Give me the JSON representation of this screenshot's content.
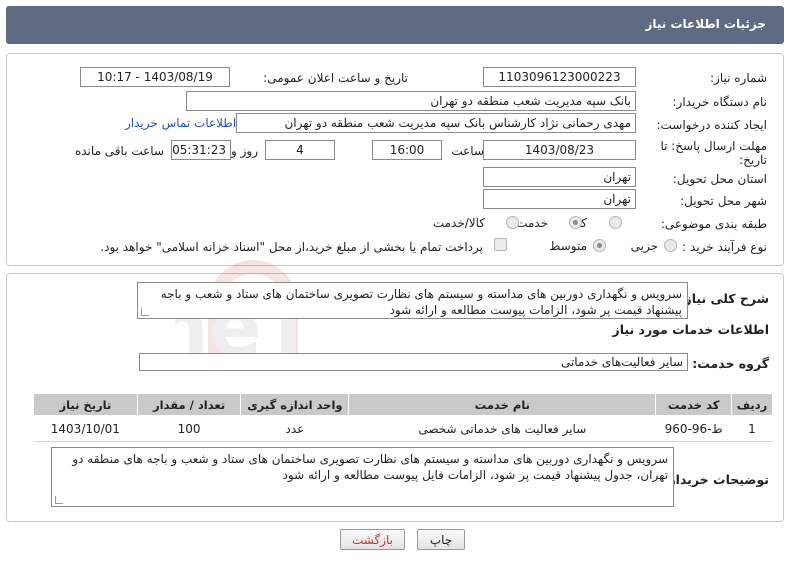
{
  "header": {
    "title": "جزئیات اطلاعات نیاز"
  },
  "fields": {
    "need_number_label": "شماره نیاز:",
    "need_number": "1103096123000223",
    "announce_datetime_label": "تاریخ و ساعت اعلان عمومی:",
    "announce_datetime": "1403/08/19 - 10:17",
    "buyer_org_label": "نام دستگاه خریدار:",
    "buyer_org": "بانک سپه مدیریت شعب منطقه دو تهران",
    "creator_label": "ایجاد کننده درخواست:",
    "creator": "مهدی رحمانی نژاد کارشناس بانک سپه مدیریت شعب منطقه دو تهران",
    "buyer_contact_link": "اطلاعات تماس خریدار",
    "deadline_label_line1": "مهلت ارسال پاسخ: تا",
    "deadline_label_line2": "تاریخ:",
    "deadline_date": "1403/08/23",
    "time_label": "ساعت",
    "deadline_time": "16:00",
    "days_value": "4",
    "days_label": "روز و",
    "remaining_time": "05:31:23",
    "remaining_label": "ساعت باقی مانده",
    "province_label": "استان محل تحویل:",
    "province": "تهران",
    "city_label": "شهر محل تحویل:",
    "city": "تهران",
    "category_label": "طبقه بندی موضوعی:",
    "category_options": [
      "کالا",
      "خدمت",
      "کالا/خدمت"
    ],
    "process_label": "نوع فرآیند خرید :",
    "process_options": [
      "جزیی",
      "متوسط"
    ],
    "payment_note": "پرداخت تمام یا بخشی از مبلغ خرید،از محل \"اسناد خزانه اسلامی\" خواهد بود."
  },
  "summary": {
    "label": "شرح کلی نیاز:",
    "text": "سرویس و نگهداری دوربین های مداسته و سیستم های نظارت تصویری ساختمان های ستاد و شعب و باجه پیشنهاد قیمت پر شود، الزامات  پیوست مطالعه و ارائه شود"
  },
  "services_info": {
    "section_title": "اطلاعات خدمات مورد نیاز",
    "group_label": "گروه خدمت:",
    "group_value": "سایر فعالیت‌های خدماتی"
  },
  "table": {
    "headers": [
      "ردیف",
      "کد خدمت",
      "نام خدمت",
      "واحد اندازه گیری",
      "تعداد / مقدار",
      "تاریخ نیاز"
    ],
    "rows": [
      [
        "1",
        "ط-96-960",
        "سایر فعالیت های خدماتی شخصی",
        "عدد",
        "100",
        "1403/10/01"
      ]
    ]
  },
  "buyer_notes": {
    "label": "توضیحات خریدار:",
    "text": "سرویس و نگهداری دوربین های مداسته و سیستم های نظارت تصویری ساختمان های ستاد و شعب و باجه های منطقه دو تهران، جدول پیشنهاد قیمت پر شود، الزامات فایل پیوست مطالعه و  ارائه شود"
  },
  "buttons": {
    "print": "چاپ",
    "back": "بازگشت"
  },
  "colors": {
    "header_bg": "#5e6b83",
    "link": "#1f55c4",
    "back_text": "#c0392b"
  }
}
